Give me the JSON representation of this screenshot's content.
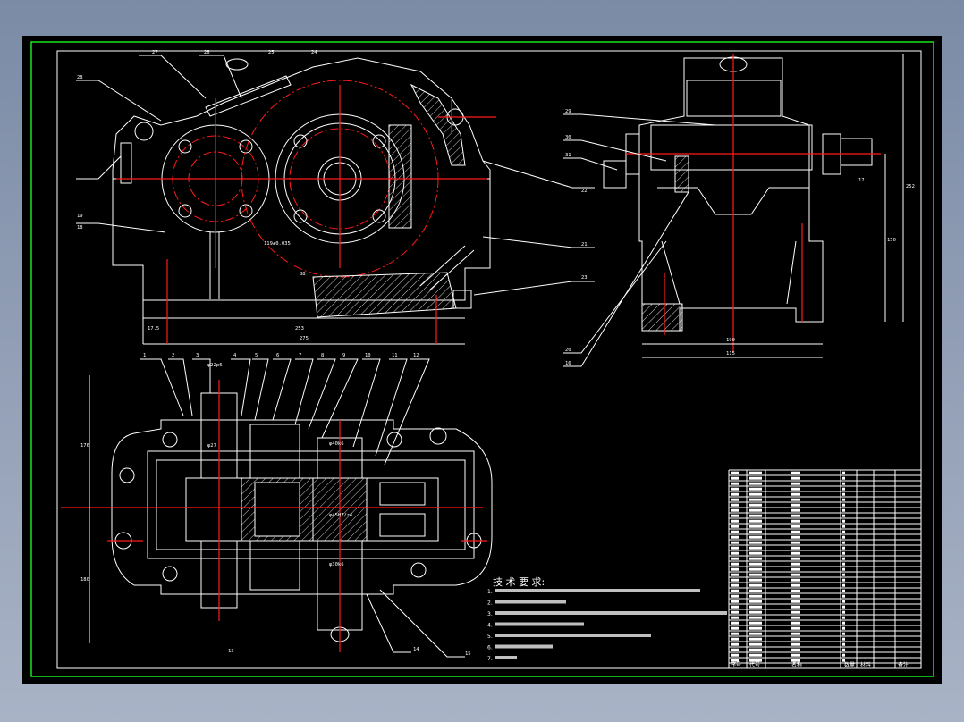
{
  "drawing": {
    "colors": {
      "background": "#000000",
      "outline": "#ffffff",
      "centerline": "#ff1a1a",
      "frame": "#19e619"
    },
    "front_view": {
      "callouts": [
        "27",
        "26",
        "25",
        "24",
        "28",
        "19",
        "18"
      ],
      "dims": [
        "17.5",
        "253",
        "275",
        "119±0.035",
        "88"
      ]
    },
    "side_view": {
      "callouts": [
        "29",
        "30",
        "31",
        "22",
        "21",
        "23",
        "20",
        "16",
        "17"
      ],
      "dims": [
        "190",
        "115",
        "252",
        "150"
      ]
    },
    "plan_view": {
      "callouts": [
        "1",
        "2",
        "3",
        "4",
        "5",
        "6",
        "7",
        "8",
        "9",
        "10",
        "11",
        "12",
        "13",
        "14",
        "15"
      ],
      "dims": [
        "φ22p6",
        "φ40k6",
        "φ45H7/r6",
        "φ30k6",
        "φ27",
        "176",
        "180"
      ]
    },
    "technical_requirements": {
      "title": "技 术 要 求:",
      "lines": [
        "1.",
        "2.",
        "3.",
        "4.",
        "5.",
        "6.",
        "7."
      ]
    },
    "parts_list": {
      "footer": [
        "序号",
        "代号",
        "名称",
        "数量",
        "材料",
        "备注"
      ]
    }
  }
}
